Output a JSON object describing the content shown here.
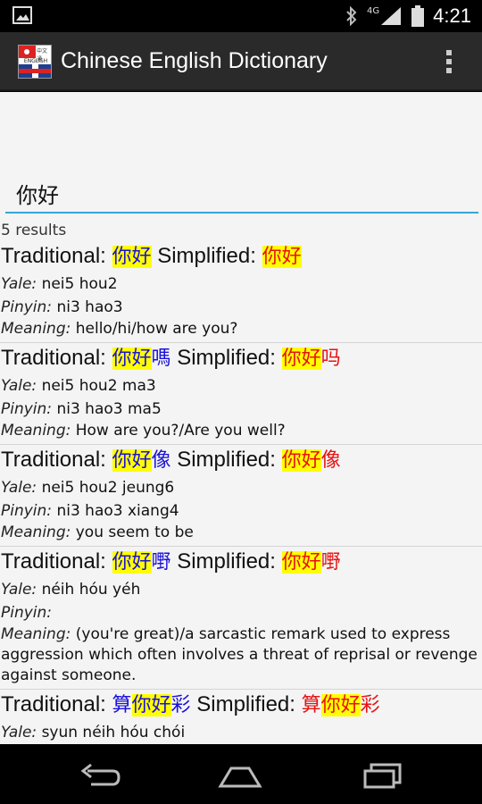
{
  "status": {
    "time": "4:21",
    "network": "4G",
    "icons": [
      "image-icon",
      "bluetooth-icon",
      "signal-icon",
      "battery-icon"
    ]
  },
  "app": {
    "title": "Chinese English Dictionary",
    "icon_text": "中文通",
    "icon_english": "ENGLISH"
  },
  "search": {
    "value": "你好",
    "placeholder": ""
  },
  "results": {
    "count_text": "5 results",
    "labels": {
      "traditional": "Traditional:",
      "simplified": "Simplified:",
      "yale": "Yale:",
      "pinyin": "Pinyin:",
      "meaning": "Meaning:"
    },
    "items": [
      {
        "trad_pre": "",
        "trad_hl": "你好",
        "trad_post": "",
        "simp_pre": "",
        "simp_hl": "你好",
        "simp_post": "",
        "yale": "nei5 hou2",
        "pinyin": "ni3 hao3",
        "meaning": "hello/hi/how are you?"
      },
      {
        "trad_pre": "",
        "trad_hl": "你好",
        "trad_post": "嗎",
        "simp_pre": "",
        "simp_hl": "你好",
        "simp_post": "吗",
        "yale": "nei5 hou2 ma3",
        "pinyin": "ni3 hao3 ma5",
        "meaning": "How are you?/Are you well?"
      },
      {
        "trad_pre": "",
        "trad_hl": "你好",
        "trad_post": "像",
        "simp_pre": "",
        "simp_hl": "你好",
        "simp_post": "像",
        "yale": "nei5 hou2 jeung6",
        "pinyin": "ni3 hao3 xiang4",
        "meaning": "you seem to be"
      },
      {
        "trad_pre": "",
        "trad_hl": "你好",
        "trad_post": "嘢",
        "simp_pre": "",
        "simp_hl": "你好",
        "simp_post": "嘢",
        "yale": "néih hóu yéh",
        "pinyin": "",
        "meaning": "(you're great)/a sarcastic remark used to express aggression which often involves a threat of reprisal or revenge against someone."
      },
      {
        "trad_pre": "算",
        "trad_hl": "你好",
        "trad_post": "彩",
        "simp_pre": "算",
        "simp_hl": "你好",
        "simp_post": "彩",
        "yale": "syun néih hóu chói",
        "pinyin": "",
        "meaning": ""
      }
    ]
  },
  "navigation": {
    "back": "back-icon",
    "home": "home-icon",
    "recents": "recents-icon"
  }
}
